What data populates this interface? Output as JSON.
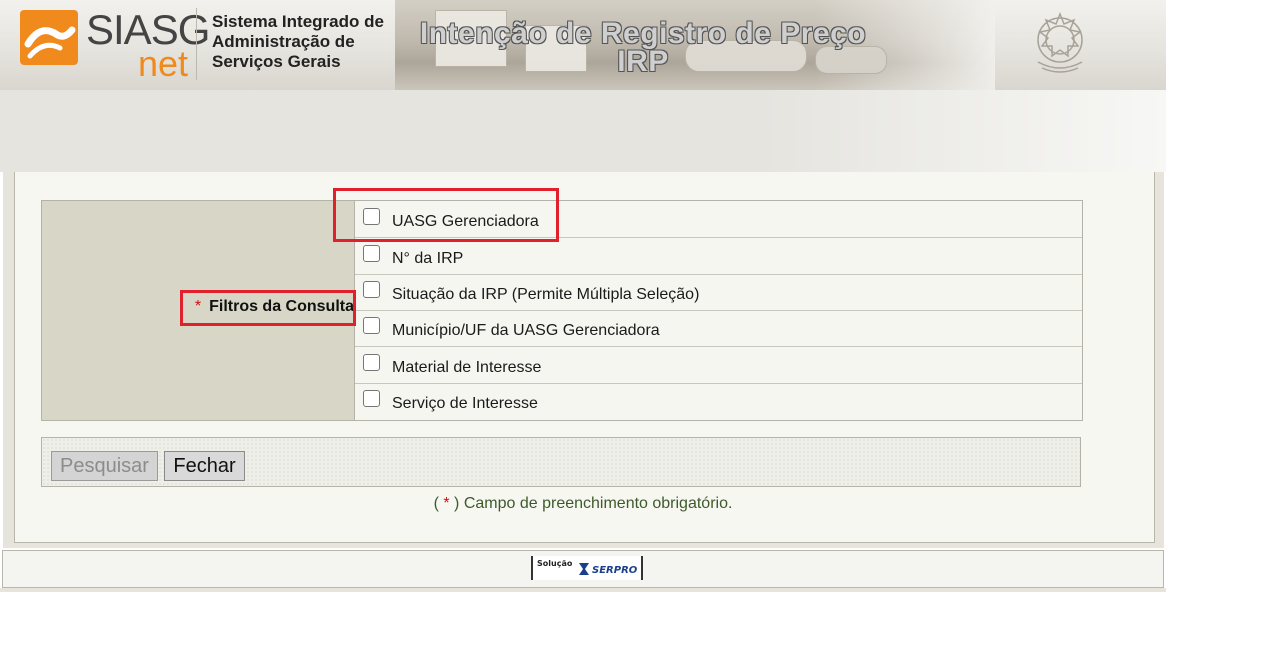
{
  "header": {
    "logo_siasg": "SIASG",
    "logo_net": "net",
    "system_name_lines": [
      "Sistema Integrado de",
      "Administração de",
      "Serviços Gerais"
    ],
    "title_line1": "Intenção de Registro de Preço",
    "title_line2": "IRP"
  },
  "filters": {
    "required_marker": "*",
    "label": "Filtros da Consulta",
    "options": [
      {
        "label": "UASG Gerenciadora",
        "checked": false
      },
      {
        "label": "N° da IRP",
        "checked": false
      },
      {
        "label": "Situação da IRP (Permite Múltipla Seleção)",
        "checked": false
      },
      {
        "label": "Município/UF da UASG Gerenciadora",
        "checked": false
      },
      {
        "label": "Material de Interesse",
        "checked": false
      },
      {
        "label": "Serviço de Interesse",
        "checked": false
      }
    ]
  },
  "buttons": {
    "search_label": "Pesquisar",
    "search_enabled": false,
    "close_label": "Fechar"
  },
  "note": {
    "open": "(",
    "marker": "*",
    "text": ") Campo de preenchimento obrigatório."
  },
  "footer": {
    "solution_label": "Solução",
    "vendor": "SERPRO"
  },
  "colors": {
    "brand_orange": "#f08a1d",
    "highlight_red": "#e0202a",
    "required_red": "#cc1111"
  }
}
